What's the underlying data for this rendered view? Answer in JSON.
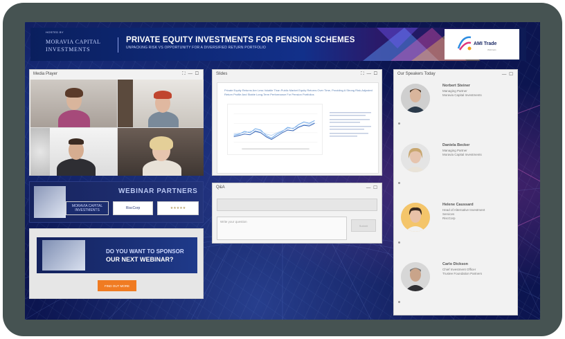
{
  "banner": {
    "hosted_by": "HOSTED BY",
    "org_line1": "MORAVIA CAPITAL",
    "org_line2": "INVESTMENTS",
    "title": "PRIVATE EQUITY INVESTMENTS FOR PENSION SCHEMES",
    "subtitle": "UNPACKING RISK VS OPPORTUNITY FOR A DIVERSIFIED RETURN PORTFOLIO",
    "partner_logo_name": "AMI Trade",
    "partner_logo_tag": "Webinars"
  },
  "video_panel": {
    "title": "Media Player",
    "controls": "⛶ — ☐"
  },
  "slides_panel": {
    "title": "Slides",
    "controls": "⛶ — ☐",
    "slide_text": "Private Equity Returns Are Less Volatile Than Public Market Equity Returns Over Time, Providing A Strong Risk-Adjusted Return Profile And Stable Long-Term Performance For Pension Portfolios"
  },
  "qa_panel": {
    "title": "Q&A",
    "controls": "— ☐",
    "input_placeholder": "Write your question",
    "send_label": "Submit"
  },
  "partners": {
    "title": "WEBINAR PARTNERS",
    "logos": [
      "MORAVIA CAPITAL INVESTMENTS",
      "RiscCorp",
      "★★★★★"
    ]
  },
  "sponsor": {
    "line1": "DO YOU WANT TO SPONSOR",
    "line2": "OUR NEXT WEBINAR?",
    "button_label": "FIND OUT MORE"
  },
  "speakers_panel": {
    "title": "Our Speakers Today",
    "controls": "— ☐",
    "speakers": [
      {
        "name": "Norbert Steiner",
        "role1": "Managing Partner",
        "role2": "Moravia Capital Investments",
        "role3": ""
      },
      {
        "name": "Daniela Becker",
        "role1": "Managing Partner",
        "role2": "Moravia Capital Investments",
        "role3": ""
      },
      {
        "name": "Helene Caussard",
        "role1": "Head of Alternative Investment",
        "role2": "Services",
        "role3": "RiscCorp"
      },
      {
        "name": "Carlo Dickson",
        "role1": "Chief Investment Officer",
        "role2": "Trustee Foundation Partners",
        "role3": ""
      }
    ]
  },
  "colors": {
    "screen_bg": "#0c1550",
    "frame": "#465352",
    "accent_orange": "#f07b22",
    "panel_bg": "#f2f2f2"
  }
}
